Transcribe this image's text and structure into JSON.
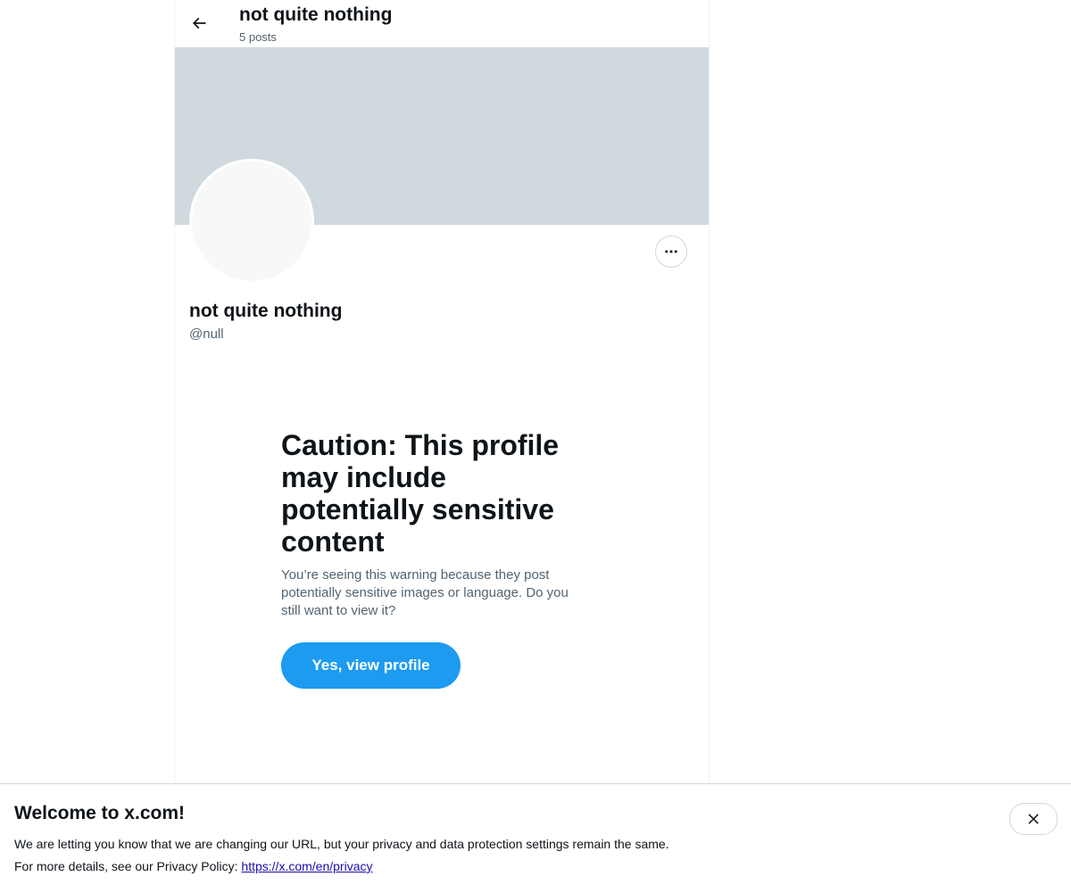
{
  "header": {
    "title": "not quite nothing",
    "post_count": "5 posts",
    "back_icon": "arrow-left-icon"
  },
  "profile": {
    "display_name": "not quite nothing",
    "handle": "@null",
    "more_icon": "more-horizontal-icon",
    "banner_color": "#cfd9de",
    "avatar_color": "#f7f9f9"
  },
  "caution": {
    "title": "Caution: This profile may include potentially sensitive content",
    "body": "You’re seeing this warning because they post potentially sensitive images or language. Do you still want to view it?",
    "button_label": "Yes, view profile",
    "button_color": "#1d9bf0"
  },
  "notice": {
    "title": "Welcome to x.com!",
    "line1": "We are letting you know that we are changing our URL, but your privacy and data protection settings remain the same.",
    "line2_prefix": "For more details, see our Privacy Policy: ",
    "link_text": "https://x.com/en/privacy",
    "close_icon": "close-icon"
  }
}
